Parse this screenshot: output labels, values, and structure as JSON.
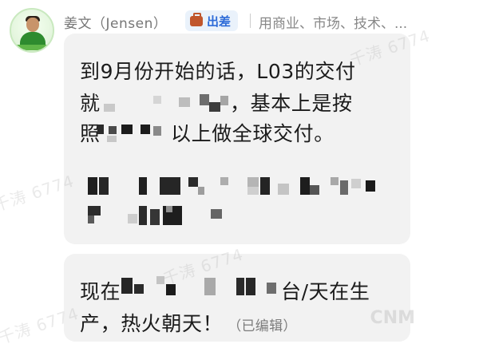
{
  "sender": {
    "name": "姜文（Jensen）",
    "status": "出差",
    "status_icon": "suitcase-icon",
    "tags": "用商业、市场、技术、..."
  },
  "messages": [
    {
      "lines": [
        "到9月份开始的话，L03的交付",
        "就",
        "，基本上是按",
        "照",
        "以上做全球交付。"
      ]
    },
    {
      "line1_start": "现在",
      "line1_end": "台/天在生",
      "line2": "产，热火朝天！",
      "edited": "（已编辑）"
    }
  ],
  "watermark": {
    "text": "千涛 6774",
    "corner": "CNM"
  },
  "colors": {
    "bubble": "#f2f2f2",
    "status_badge_bg": "#eaf2fb",
    "status_text": "#2d6bd8"
  }
}
